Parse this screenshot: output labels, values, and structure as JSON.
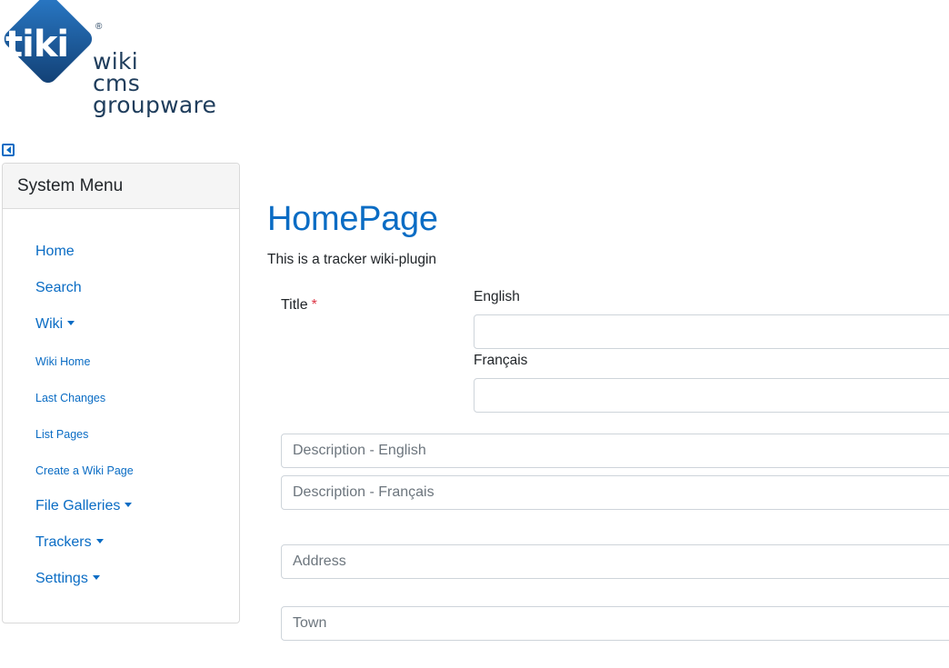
{
  "logo": {
    "mark_text": "tiki",
    "registered": "®",
    "lines": [
      "wiki",
      "cms",
      "groupware"
    ],
    "colors": {
      "diamond": "#1a5fa8",
      "text": "#1f3d5c"
    }
  },
  "sidebar": {
    "toggle_icon": "caret-left-square-icon",
    "title": "System Menu",
    "items": [
      {
        "label": "Home",
        "size": "big",
        "dropdown": false
      },
      {
        "label": "Search",
        "size": "big",
        "dropdown": false
      },
      {
        "label": "Wiki",
        "size": "big",
        "dropdown": true
      },
      {
        "label": "Wiki Home",
        "size": "small",
        "dropdown": false
      },
      {
        "label": "Last Changes",
        "size": "small",
        "dropdown": false
      },
      {
        "label": "List Pages",
        "size": "small",
        "dropdown": false
      },
      {
        "label": "Create a Wiki Page",
        "size": "small",
        "dropdown": false
      },
      {
        "label": "File Galleries",
        "size": "big",
        "dropdown": true
      },
      {
        "label": "Trackers",
        "size": "big",
        "dropdown": true
      },
      {
        "label": "Settings",
        "size": "big",
        "dropdown": true
      }
    ]
  },
  "main": {
    "title": "HomePage",
    "intro": "This is a tracker wiki-plugin",
    "form": {
      "title_field": {
        "label": "Title",
        "required_mark": "*",
        "languages": [
          {
            "label": "English",
            "value": ""
          },
          {
            "label": "Français",
            "value": ""
          }
        ]
      },
      "description_en_placeholder": "Description - English",
      "description_fr_placeholder": "Description - Français",
      "address_placeholder": "Address",
      "town_placeholder": "Town"
    }
  },
  "colors": {
    "link": "#0a6cc4",
    "required": "#dc3545",
    "border": "#ced4da"
  }
}
